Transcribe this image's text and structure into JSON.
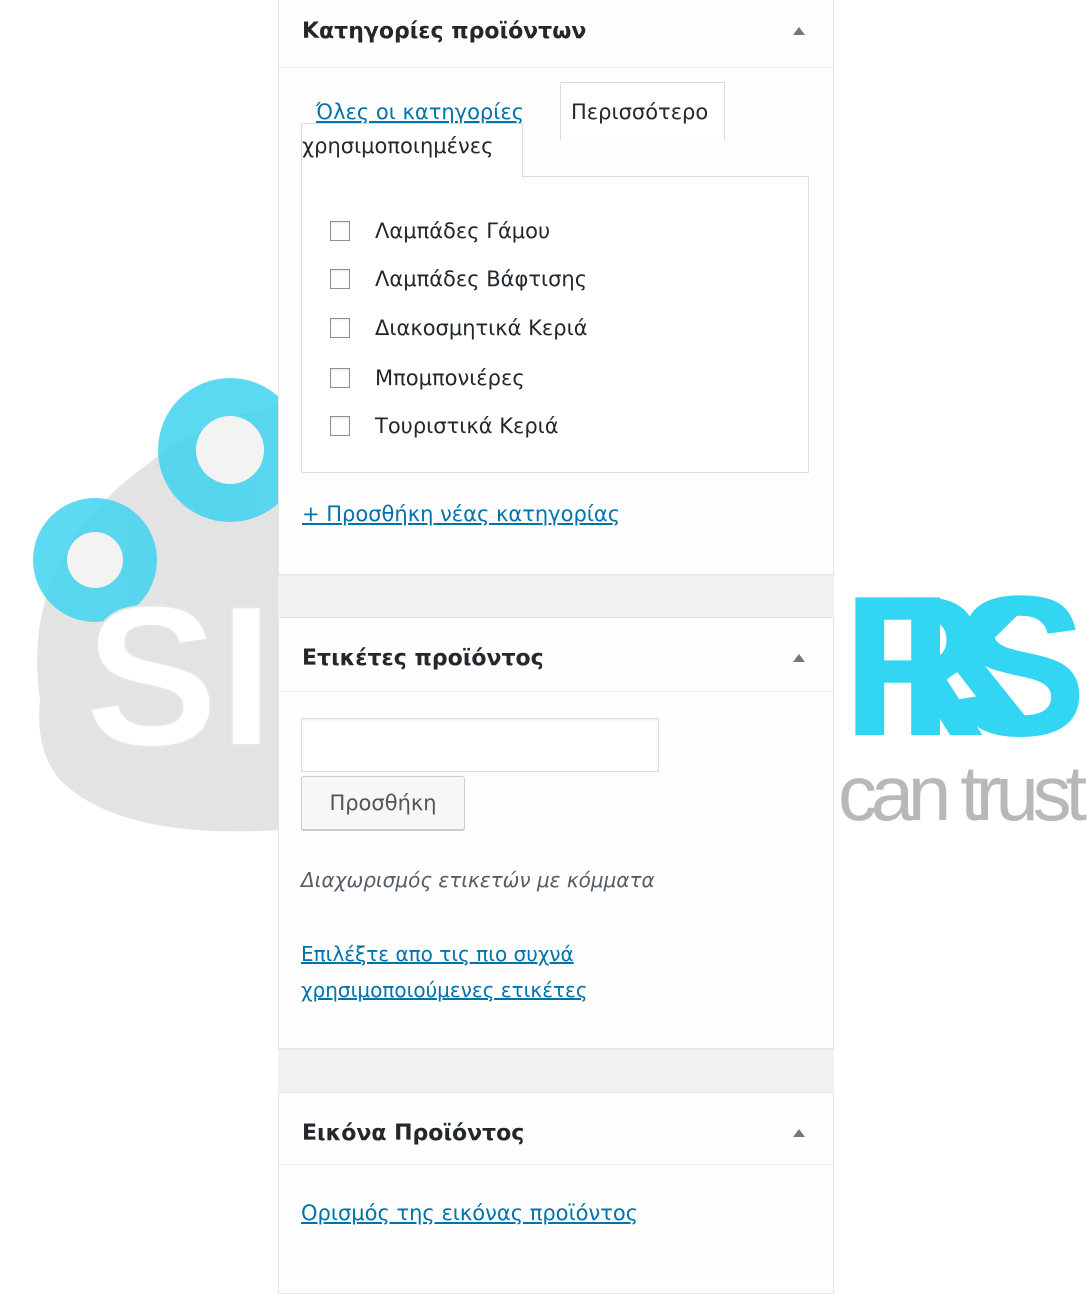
{
  "categories_box": {
    "title": "Κατηγορίες προϊόντων",
    "tab_all": "Όλες οι κατηγορίες",
    "tab_popular_line1": "Περισσότερο",
    "tab_popular_line2": "χρησιμοποιημένες",
    "items": [
      {
        "label": "Λαμπάδες Γάμου",
        "checked": false
      },
      {
        "label": "Λαμπάδες Βάφτισης",
        "checked": false
      },
      {
        "label": "Διακοσμητικά Κεριά",
        "checked": false
      },
      {
        "label": "Μπομπονιέρες",
        "checked": false
      },
      {
        "label": "Τουριστικά Κεριά",
        "checked": false
      }
    ],
    "add_new_link": "+ Προσθήκη νέας κατηγορίας"
  },
  "tags_box": {
    "title": "Ετικέτες προϊόντος",
    "input_value": "",
    "add_button": "Προσθήκη",
    "howto": "Διαχωρισμός ετικετών με κόμματα",
    "tag_cloud_link": "Επιλέξτε απο τις πιο συχνά χρησιμοποιούμενες ετικέτες"
  },
  "image_box": {
    "title": "Εικόνα Προϊόντος",
    "set_image_link": "Ορισμός της εικόνας προϊόντος"
  },
  "watermark": {
    "brand_left": "SI",
    "brand_right": "RKS",
    "tagline_fragment": "can trust",
    "colors": {
      "cyan": "#33d6f2",
      "gray": "#d9d9d9",
      "text_gray": "#b0b0b0"
    }
  },
  "colors": {
    "link": "#0073aa",
    "text": "#23282d",
    "border": "#dddddd",
    "background": "#f1f1f1"
  }
}
